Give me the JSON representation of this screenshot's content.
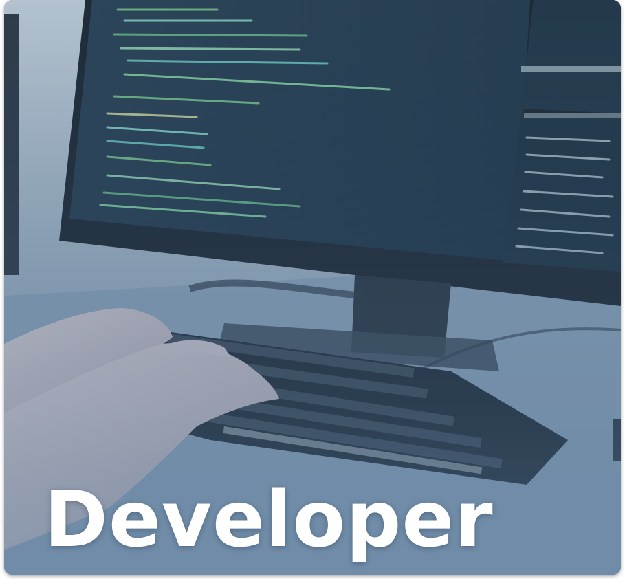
{
  "card": {
    "title": "Developer"
  },
  "image": {
    "subject": "hands-typing-on-keyboard-with-code-monitor"
  },
  "colors": {
    "tint": "#5f7f9f",
    "screen": "#1d3344",
    "title": "#ffffff"
  }
}
